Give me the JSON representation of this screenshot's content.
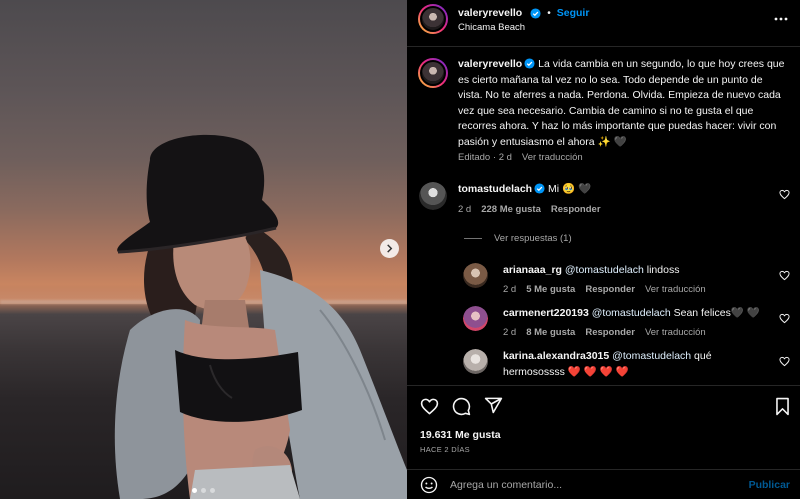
{
  "post": {
    "author": "valeryrevello",
    "follow_label": "Seguir",
    "location": "Chicama Beach",
    "caption": "La vida cambia en un segundo, lo que hoy crees que es cierto mañana tal vez no lo sea. Todo depende de un punto de vista. No te aferres a nada. Perdona. Olvida. Empieza de nuevo cada vez que sea necesario. Cambia de camino si no te gusta el que recorres ahora. Y haz lo más importante que puedas hacer: vivir con pasión y entusiasmo el ahora ✨ 🖤",
    "caption_meta": {
      "edited": "Editado",
      "age": "2 d",
      "translate": "Ver traducción"
    },
    "carousel": {
      "total_slides": 3,
      "current_slide": 1
    }
  },
  "comments": [
    {
      "user": "tomastudelach",
      "verified": true,
      "text": "Mi 🥹 🖤",
      "age": "2 d",
      "likes": "228 Me gusta",
      "reply": "Responder",
      "view_replies": "Ver respuestas (1)"
    },
    {
      "user": "arianaaa_rg",
      "mention": "@tomastudelach",
      "text": " lindoss",
      "age": "2 d",
      "likes": "5 Me gusta",
      "reply": "Responder",
      "translate": "Ver traducción"
    },
    {
      "user": "carmenert220193",
      "mention": "@tomastudelach",
      "text": " Sean felices🖤 🖤",
      "age": "2 d",
      "likes": "8 Me gusta",
      "reply": "Responder",
      "translate": "Ver traducción"
    },
    {
      "user": "karina.alexandra3015",
      "mention": "@tomastudelach",
      "text": " qué",
      "text_line2": "hermosossss ❤️ ❤️ ❤️ ❤️"
    }
  ],
  "footer": {
    "likes": "19.631 Me gusta",
    "time_ago": "HACE 2 DÍAS",
    "comment_placeholder": "Agrega un comentario...",
    "publish_label": "Publicar"
  },
  "colors": {
    "accent": "#0095f6",
    "background": "#000000",
    "muted": "#a8a8a8",
    "divider": "#262626"
  }
}
